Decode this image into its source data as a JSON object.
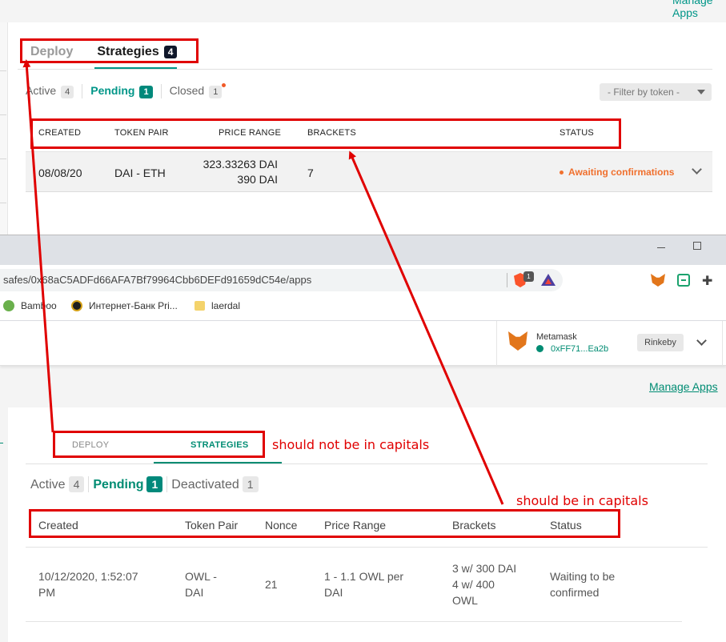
{
  "top_panel": {
    "corner_link": "Manage Apps",
    "tabs": [
      {
        "label": "Deploy",
        "active": false
      },
      {
        "label": "Strategies",
        "active": true,
        "badge": "4"
      }
    ],
    "filters": [
      {
        "label": "Active",
        "count": "4",
        "active": false
      },
      {
        "label": "Pending",
        "count": "1",
        "active": true
      },
      {
        "label": "Closed",
        "count": "1",
        "active": false
      }
    ],
    "filter_select": "- Filter by token -",
    "columns": [
      "CREATED",
      "TOKEN PAIR",
      "PRICE RANGE",
      "BRACKETS",
      "STATUS"
    ],
    "row": {
      "created": "08/08/20",
      "token_pair": "DAI - ETH",
      "price_low": "323.33263 DAI",
      "price_high": "390 DAI",
      "brackets": "7",
      "status": "Awaiting confirmations"
    }
  },
  "browser": {
    "url": "safes/0x68aC5ADFd66AFA7Bf79964Cbb6DEFd91659dC54e/apps",
    "brave_badge": "1",
    "bookmarks": [
      {
        "label": "Bamboo"
      },
      {
        "label": "Интернет-Банк Pri..."
      },
      {
        "label": "laerdal"
      }
    ],
    "puzzle_glyph": "✚"
  },
  "app_header": {
    "wallet_name": "Metamask",
    "wallet_address": "0xFF71...Ea2b",
    "network": "Rinkeby"
  },
  "bottom_panel": {
    "manage_apps": "Manage Apps",
    "tabs": [
      {
        "label": "DEPLOY",
        "active": false
      },
      {
        "label": "STRATEGIES",
        "active": true
      }
    ],
    "filters": [
      {
        "label": "Active",
        "count": "4",
        "active": false
      },
      {
        "label": "Pending",
        "count": "1",
        "active": true
      },
      {
        "label": "Deactivated",
        "count": "1",
        "active": false
      }
    ],
    "columns": [
      "Created",
      "Token Pair",
      "Nonce",
      "Price Range",
      "Brackets",
      "Status"
    ],
    "row": {
      "created_line1": "10/12/2020, 1:52:07",
      "created_line2": "PM",
      "token_pair_line1": "OWL -",
      "token_pair_line2": "DAI",
      "nonce": "21",
      "price_range_line1": "1 - 1.1 OWL per",
      "price_range_line2": "DAI",
      "brackets_line1": "3 w/ 300 DAI",
      "brackets_line2": "4 w/ 400",
      "brackets_line3": "OWL",
      "status_line1": "Waiting to be",
      "status_line2": "confirmed"
    }
  },
  "annotations": {
    "note_tabs": "should not be in capitals",
    "note_columns": "should be in capitals",
    "color": "#e00000"
  }
}
